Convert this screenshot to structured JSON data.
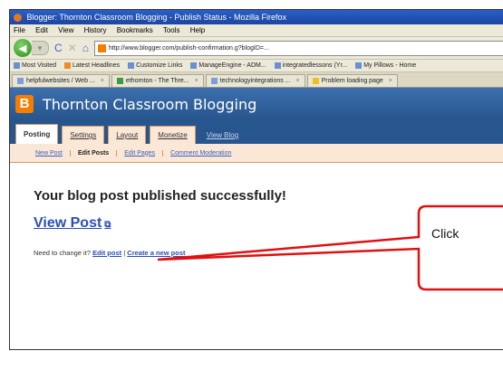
{
  "window": {
    "title": "Blogger: Thornton Classroom Blogging - Publish Status - Mozilla Firefox"
  },
  "menu": [
    "File",
    "Edit",
    "View",
    "History",
    "Bookmarks",
    "Tools",
    "Help"
  ],
  "nav": {
    "back_glyph": "◀",
    "forward_glyph": "▾",
    "reload_glyph": "C",
    "stop_glyph": "✕",
    "home_glyph": "⌂",
    "url": "http://www.blogger.com/publish-confirmation.g?blogID=..."
  },
  "bookmarks": [
    "Most Visited",
    "Latest Headlines",
    "Customize Links",
    "ManageEngine - ADM...",
    "integratedlessons (Yr...",
    "My Pillows - Home"
  ],
  "tabs": [
    "helpfulwebsites / Web ...",
    "ethornton - The Thre...",
    "technologyintegrations ...",
    "Problem loading page"
  ],
  "blogger": {
    "logo_letter": "B",
    "blog_title": "Thornton Classroom Blogging",
    "main_tabs": [
      "Posting",
      "Settings",
      "Layout",
      "Monetize",
      "View Blog"
    ],
    "sub_tabs": [
      "New Post",
      "Edit Posts",
      "Edit Pages",
      "Comment Moderation"
    ]
  },
  "content": {
    "success_message": "Your blog post published successfully!",
    "view_post_label": "View Post",
    "ext_icon_glyph": "⧉",
    "need_change_prefix": "Need to change it?",
    "edit_post_link": "Edit post",
    "separator": "|",
    "create_new_post_link": "Create a new post"
  },
  "annotation": {
    "callout_text": "Click"
  },
  "colors": {
    "blogger_orange": "#f57d00",
    "blogger_blue": "#27558d",
    "link_blue": "#2a4fb5",
    "arrow_red": "#e01010"
  }
}
